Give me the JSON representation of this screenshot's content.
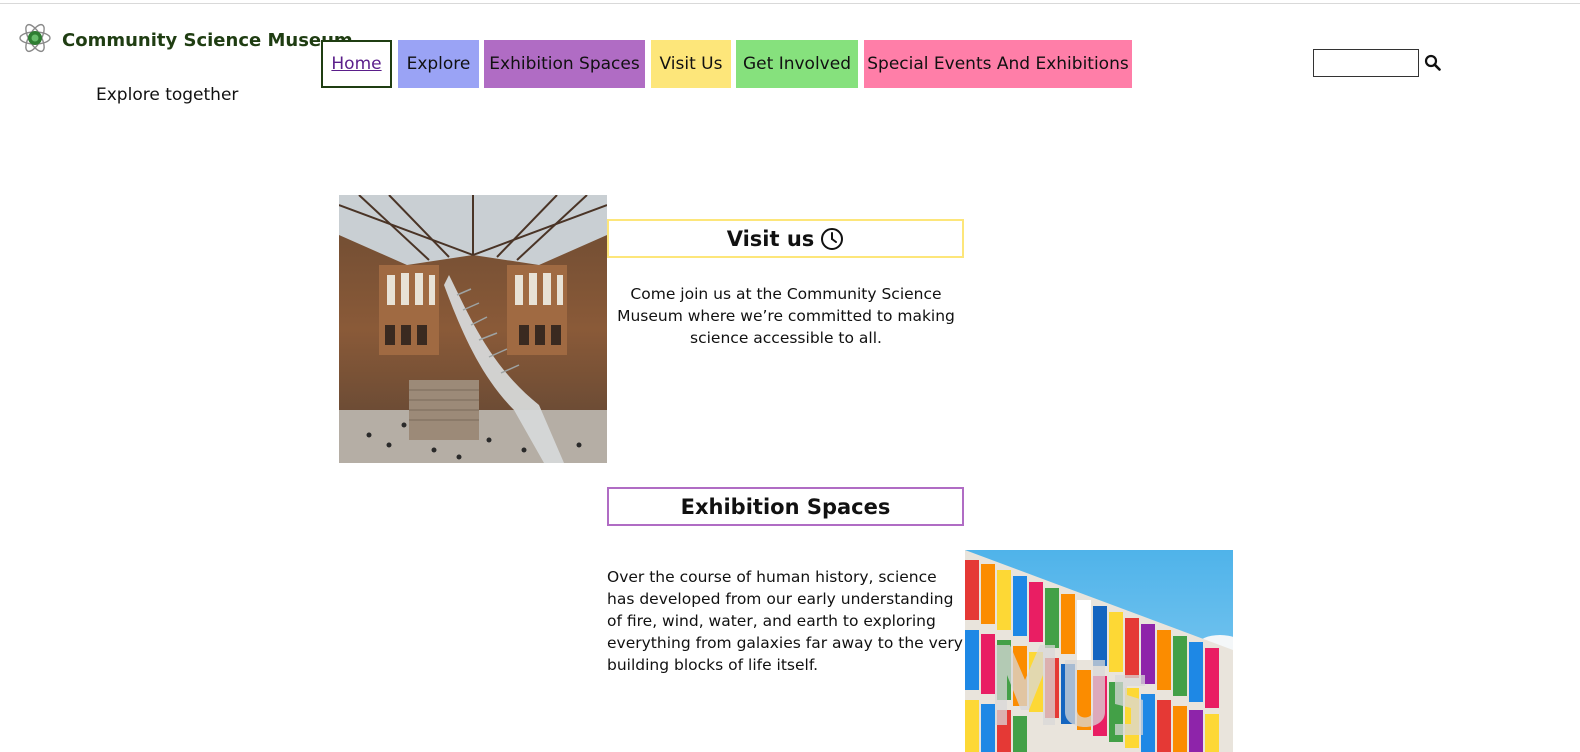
{
  "header": {
    "brand": "Community Science Museum",
    "tagline": "Explore together"
  },
  "nav": {
    "items": [
      {
        "label": "Home",
        "color": "#ffffff"
      },
      {
        "label": "Explore",
        "color": "#9aa3f5"
      },
      {
        "label": "Exhibition Spaces",
        "color": "#b06cc4"
      },
      {
        "label": "Visit Us",
        "color": "#fde67a"
      },
      {
        "label": "Get Involved",
        "color": "#86e17d"
      },
      {
        "label": "Special Events And Exhibitions",
        "color": "#ff7ea8"
      }
    ]
  },
  "search": {
    "value": "",
    "icon": "search-icon"
  },
  "visit": {
    "heading": "Visit us",
    "icon": "clock-icon",
    "text": "Come join us at the Community Science Museum where we’re committed to making science accessible to all.",
    "image": "museum-hall-whale-skeleton-photo"
  },
  "exhibition": {
    "heading": "Exhibition Spaces",
    "text": "Over the course of human history, science has developed from our early understanding of fire, wind, water, and earth to exploring everything from galaxies far away to the very building blocks of life itself.",
    "image": "colorful-museum-facade-photo"
  },
  "colors": {
    "brand": "#1f3d12",
    "visited_link": "#5a1e8a"
  }
}
